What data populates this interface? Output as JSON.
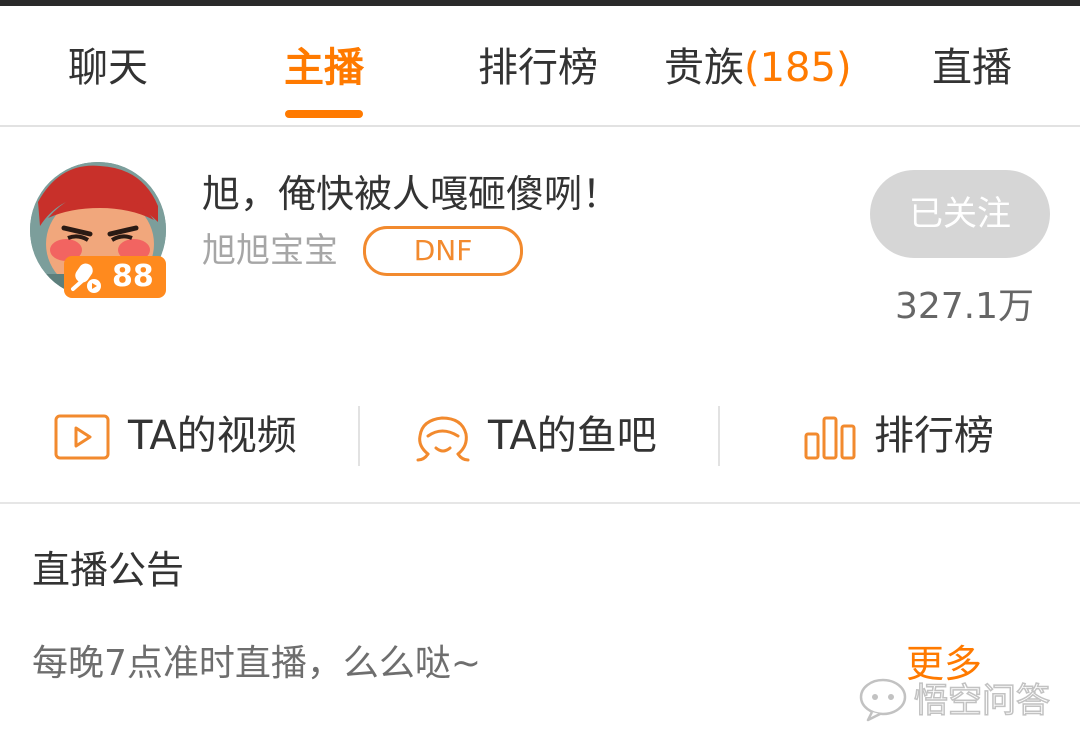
{
  "tabs": [
    {
      "label": "聊天"
    },
    {
      "label": "主播",
      "active": true
    },
    {
      "label": "排行榜"
    },
    {
      "label": "贵族",
      "count": "(185)"
    },
    {
      "label": "直播"
    }
  ],
  "anchor": {
    "room_title": "旭，俺快被人嘎砸傻咧！",
    "name": "旭旭宝宝",
    "category_tag": "DNF",
    "level": "88",
    "follow_button": "已关注",
    "follower_count": "327.1万"
  },
  "actions": [
    {
      "label": "TA的视频",
      "icon": "video-icon"
    },
    {
      "label": "TA的鱼吧",
      "icon": "fish-bar-icon"
    },
    {
      "label": "排行榜",
      "icon": "ranking-icon"
    }
  ],
  "notice": {
    "title": "直播公告",
    "text": "每晚7点准时直播，么么哒~",
    "more": "更多"
  },
  "watermark": {
    "text": "悟空问答"
  },
  "colors": {
    "accent": "#ff7a00",
    "follow_button_bg": "#d6d6d6",
    "divider": "#e2e2e2"
  }
}
